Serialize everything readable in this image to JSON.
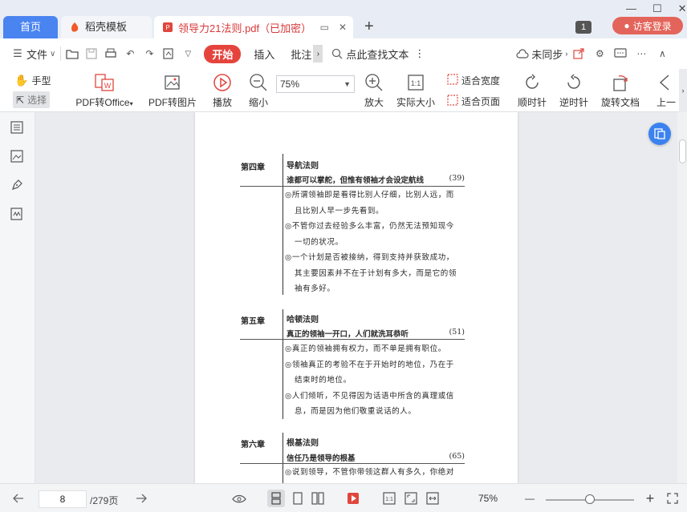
{
  "tabs": {
    "home": "首页",
    "template": "稻壳模板",
    "doc_title": "领导力21法则.pdf（已加密）",
    "page_badge": "1",
    "login": "访客登录"
  },
  "menu": {
    "file": "文件",
    "start": "开始",
    "insert": "插入",
    "annotate": "批注",
    "search": "点此查找文本",
    "sync": "未同步"
  },
  "ribbon": {
    "hand": "手型",
    "select": "选择",
    "pdf_office": "PDF转Office",
    "pdf_image": "PDF转图片",
    "play": "播放",
    "zoom_out": "缩小",
    "zoom_value": "75%",
    "zoom_in": "放大",
    "actual_size": "实际大小",
    "fit_width": "适合宽度",
    "fit_page": "适合页面",
    "rotate_cw": "顺时针",
    "rotate_ccw": "逆时针",
    "rotate_doc": "旋转文档",
    "prev": "上一"
  },
  "document": {
    "sections": [
      {
        "chapter": "第四章",
        "title": "导航法则",
        "subtitle": "谁都可以掌舵，但惟有领袖才会设定航线",
        "page": "(39)",
        "lines": [
          "◎所谓领袖即是看得比别人仔细，比别人远，而",
          "且比别人早一步先看到。",
          "◎不管你过去经验多么丰富，仍然无法预知现今",
          "一切的状况。",
          "◎一个计划是否被接纳，得到支持并获致成功，",
          "其主要因素并不在于计划有多大，而是它的领",
          "袖有多好。"
        ]
      },
      {
        "chapter": "第五章",
        "title": "哈顿法则",
        "subtitle": "真正的领袖一开口，人们就洗耳恭听",
        "page": "(51)",
        "lines": [
          "◎真正的领袖拥有权力，而不单是拥有职位。",
          "◎领袖真正的考验不在于开始时的地位，乃在于",
          "结束时的地位。",
          "◎人们倾听，不见得因为话语中所含的真理或信",
          "息，而是因为他们敬重说话的人。"
        ]
      },
      {
        "chapter": "第六章",
        "title": "根基法则",
        "subtitle": "信任乃是领导的根基",
        "page": "(65)",
        "lines": [
          "◎说到领导，不管你带领这群人有多久，你绝对"
        ]
      }
    ]
  },
  "status": {
    "current_page": "8",
    "total_pages": "/279页",
    "zoom": "75%"
  },
  "colors": {
    "accent_blue": "#4a84f0",
    "accent_red": "#e5443d",
    "doc_title_red": "#d9383a"
  }
}
